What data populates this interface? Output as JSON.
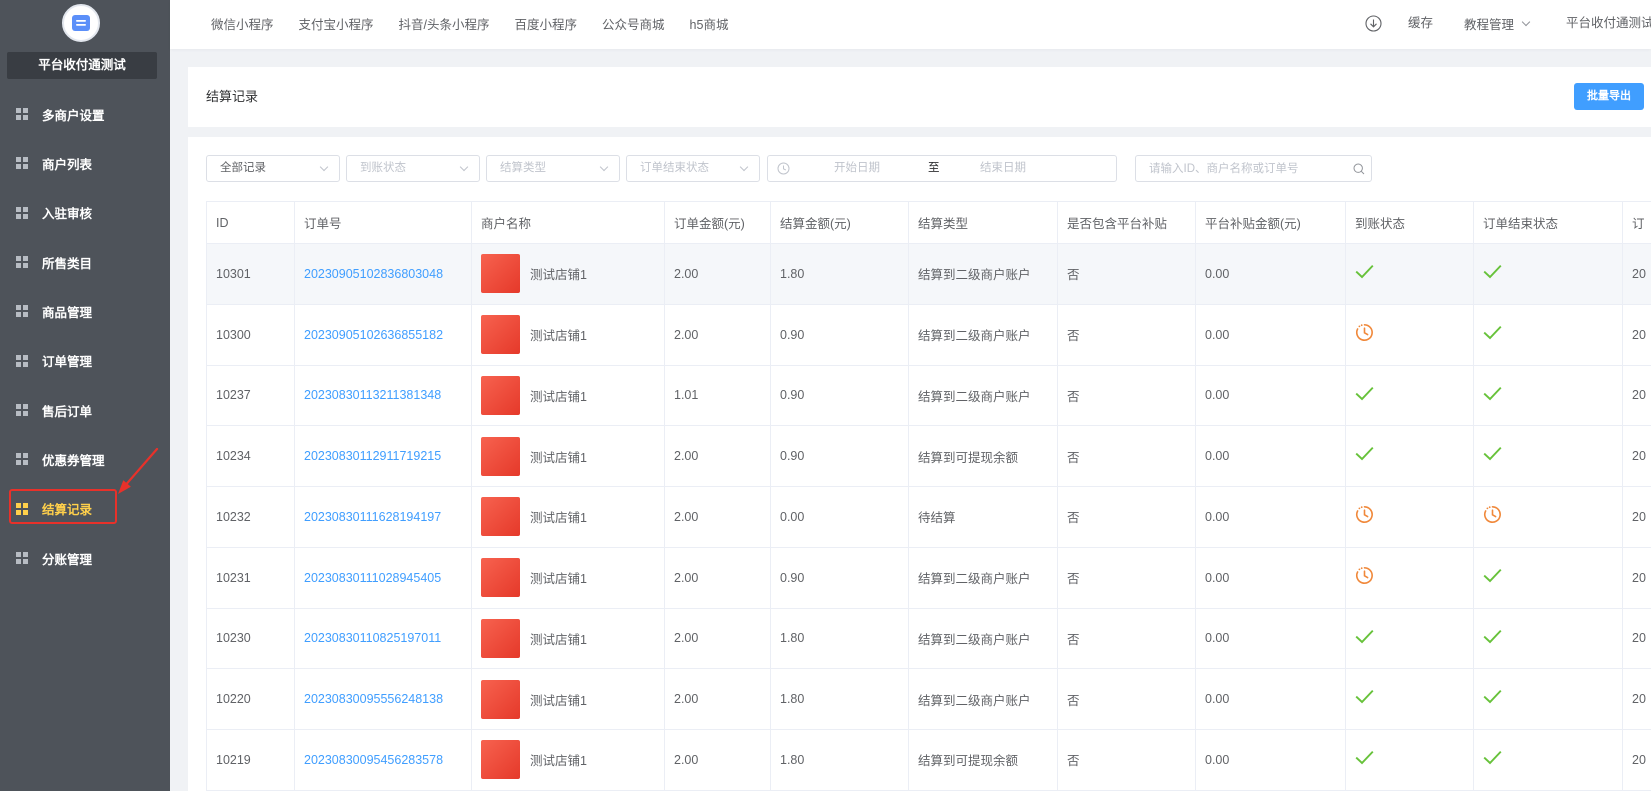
{
  "sidebar": {
    "store_name": "平台收付通测试",
    "logo_icon": "database-icon",
    "items": [
      {
        "label": "多商户设置",
        "active": false
      },
      {
        "label": "商户列表",
        "active": false
      },
      {
        "label": "入驻审核",
        "active": false
      },
      {
        "label": "所售类目",
        "active": false
      },
      {
        "label": "商品管理",
        "active": false
      },
      {
        "label": "订单管理",
        "active": false
      },
      {
        "label": "售后订单",
        "active": false
      },
      {
        "label": "优惠券管理",
        "active": false
      },
      {
        "label": "结算记录",
        "active": true
      },
      {
        "label": "分账管理",
        "active": false
      }
    ]
  },
  "topnav": {
    "tabs": [
      "微信小程序",
      "支付宝小程序",
      "抖音/头条小程序",
      "百度小程序",
      "公众号商城",
      "h5商城"
    ],
    "download_icon": "download-icon",
    "cache": "缓存",
    "tutorial": "教程管理",
    "account": "平台收付通测试"
  },
  "page": {
    "title": "结算记录",
    "export_button": "批量导出"
  },
  "filters": {
    "record_type": "全部记录",
    "arrival_status_placeholder": "到账状态",
    "settle_type_placeholder": "结算类型",
    "order_end_status_placeholder": "订单结束状态",
    "start_date_placeholder": "开始日期",
    "range_separator": "至",
    "end_date_placeholder": "结束日期",
    "search_placeholder": "请输入ID、商户名称或订单号"
  },
  "table": {
    "columns": [
      "ID",
      "订单号",
      "商户名称",
      "订单金额(元)",
      "结算金额(元)",
      "结算类型",
      "是否包含平台补贴",
      "平台补贴金额(元)",
      "到账状态",
      "订单结束状态",
      "订"
    ],
    "rows": [
      {
        "id": "10301",
        "order_no": "20230905102836803048",
        "merchant": "测试店铺1",
        "order_amount": "2.00",
        "settle_amount": "1.80",
        "settle_type": "结算到二级商户账户",
        "has_subsidy": "否",
        "subsidy_amount": "0.00",
        "arrival_status": "check-icon",
        "order_end_status": "check-icon",
        "extra": "20"
      },
      {
        "id": "10300",
        "order_no": "20230905102636855182",
        "merchant": "测试店铺1",
        "order_amount": "2.00",
        "settle_amount": "0.90",
        "settle_type": "结算到二级商户账户",
        "has_subsidy": "否",
        "subsidy_amount": "0.00",
        "arrival_status": "clock-icon",
        "order_end_status": "check-icon",
        "extra": "20"
      },
      {
        "id": "10237",
        "order_no": "20230830113211381348",
        "merchant": "测试店铺1",
        "order_amount": "1.01",
        "settle_amount": "0.90",
        "settle_type": "结算到二级商户账户",
        "has_subsidy": "否",
        "subsidy_amount": "0.00",
        "arrival_status": "check-icon",
        "order_end_status": "check-icon",
        "extra": "20"
      },
      {
        "id": "10234",
        "order_no": "20230830112911719215",
        "merchant": "测试店铺1",
        "order_amount": "2.00",
        "settle_amount": "0.90",
        "settle_type": "结算到可提现余额",
        "has_subsidy": "否",
        "subsidy_amount": "0.00",
        "arrival_status": "check-icon",
        "order_end_status": "check-icon",
        "extra": "20"
      },
      {
        "id": "10232",
        "order_no": "20230830111628194197",
        "merchant": "测试店铺1",
        "order_amount": "2.00",
        "settle_amount": "0.00",
        "settle_type": "待结算",
        "has_subsidy": "否",
        "subsidy_amount": "0.00",
        "arrival_status": "clock-icon",
        "order_end_status": "clock-icon",
        "extra": "20"
      },
      {
        "id": "10231",
        "order_no": "20230830111028945405",
        "merchant": "测试店铺1",
        "order_amount": "2.00",
        "settle_amount": "0.90",
        "settle_type": "结算到二级商户账户",
        "has_subsidy": "否",
        "subsidy_amount": "0.00",
        "arrival_status": "clock-icon",
        "order_end_status": "check-icon",
        "extra": "20"
      },
      {
        "id": "10230",
        "order_no": "20230830110825197011",
        "merchant": "测试店铺1",
        "order_amount": "2.00",
        "settle_amount": "1.80",
        "settle_type": "结算到二级商户账户",
        "has_subsidy": "否",
        "subsidy_amount": "0.00",
        "arrival_status": "check-icon",
        "order_end_status": "check-icon",
        "extra": "20"
      },
      {
        "id": "10220",
        "order_no": "20230830095556248138",
        "merchant": "测试店铺1",
        "order_amount": "2.00",
        "settle_amount": "1.80",
        "settle_type": "结算到二级商户账户",
        "has_subsidy": "否",
        "subsidy_amount": "0.00",
        "arrival_status": "check-icon",
        "order_end_status": "check-icon",
        "extra": "20"
      },
      {
        "id": "10219",
        "order_no": "20230830095456283578",
        "merchant": "测试店铺1",
        "order_amount": "2.00",
        "settle_amount": "1.80",
        "settle_type": "结算到可提现余额",
        "has_subsidy": "否",
        "subsidy_amount": "0.00",
        "arrival_status": "check-icon",
        "order_end_status": "check-icon",
        "extra": "20"
      }
    ]
  },
  "colors": {
    "accent": "#409eff",
    "sidebar_bg": "#4e535a",
    "active_menu": "#ffd04b",
    "success": "#67c23a",
    "pending": "#f0883a",
    "annotation": "#e8312a"
  }
}
